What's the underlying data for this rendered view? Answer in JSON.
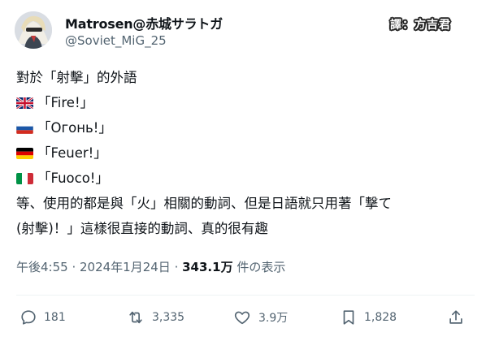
{
  "author": {
    "display_name": "Matrosen@赤城サラトガ",
    "handle": "@Soviet_MiG_25"
  },
  "translator_tag": "譯：方吉君",
  "post": {
    "intro": "對於「射擊」的外語",
    "words": [
      {
        "flag": "uk-flag-icon",
        "text": "「Fire!」"
      },
      {
        "flag": "russia-flag-icon",
        "text": "「Огонь!」"
      },
      {
        "flag": "germany-flag-icon",
        "text": "「Feuer!」"
      },
      {
        "flag": "italy-flag-icon",
        "text": "「Fuoco!」"
      }
    ],
    "conclusion_line1": "等、使用的都是與「火」相關的動詞、但是日語就只用著「撃て",
    "conclusion_line2": "(射擊)！」這樣很直接的動詞、真的很有趣"
  },
  "meta": {
    "time": "午後4:55",
    "separator1": " · ",
    "date": "2024年1月24日",
    "separator2": " · ",
    "views": "343.1万",
    "views_suffix": " 件の表示"
  },
  "actions": {
    "replies": "181",
    "reposts": "3,335",
    "likes": "3.9万",
    "bookmarks": "1,828"
  },
  "colors": {
    "text": "#0f1419",
    "secondary": "#536471",
    "divider": "#eff3f4"
  }
}
